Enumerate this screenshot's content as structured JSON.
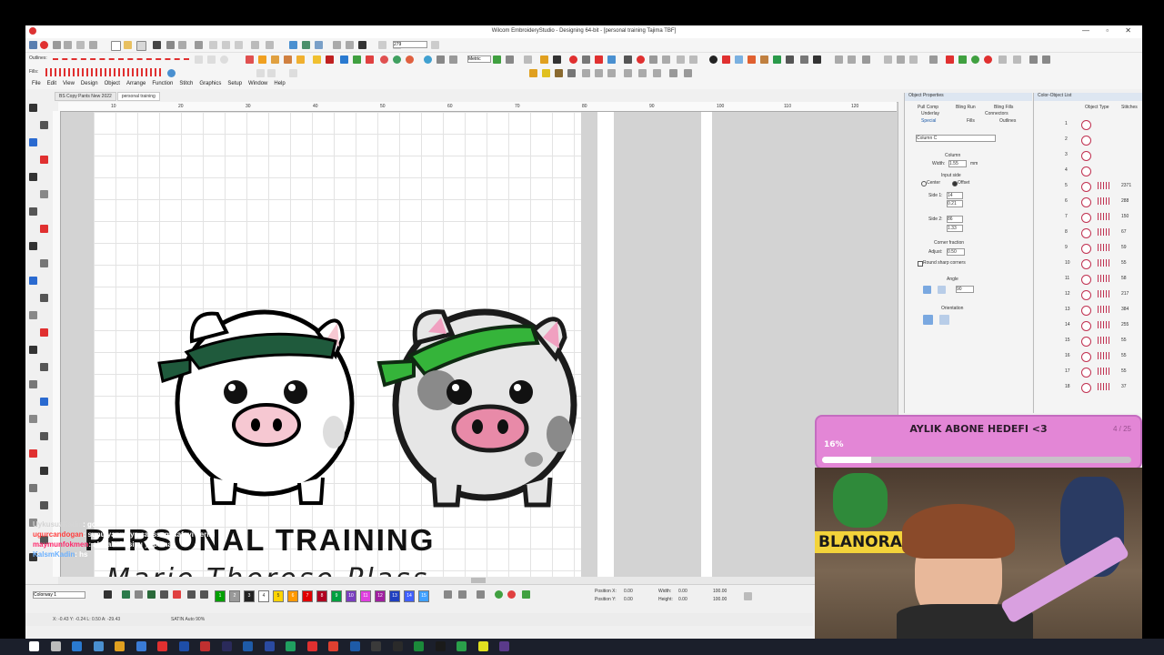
{
  "window": {
    "title": "Wilcom EmbroideryStudio - Designing 64-bit - [personal training      Tajima TBF]"
  },
  "toolbar": {
    "outlines_label": "Outlines:",
    "fills_label": "Fills:",
    "zoom_value": "279",
    "units_value": "Metric"
  },
  "menu": [
    "File",
    "Edit",
    "View",
    "Design",
    "Object",
    "Arrange",
    "Function",
    "Stitch",
    "Graphics",
    "Setup",
    "Window",
    "Help"
  ],
  "doc_tabs": [
    {
      "label": "BS Copy Pants New 2022",
      "active": false
    },
    {
      "label": "personal training",
      "active": true
    }
  ],
  "ruler_labels": [
    "10",
    "20",
    "30",
    "40",
    "50",
    "60",
    "70",
    "80",
    "90",
    "100",
    "110",
    "120"
  ],
  "design": {
    "heading": "PERSONAL TRAINING",
    "name": "Marie-Therese Plass"
  },
  "object_properties": {
    "title": "Object Properties",
    "tabs_row1": [
      "Pull Comp",
      "Bling Run",
      "Bling Fills"
    ],
    "tabs_row2": [
      "Underlay",
      "Connectors"
    ],
    "tabs_row3": [
      "Special",
      "Fills",
      "Outlines"
    ],
    "stitch_type": "Column C",
    "column_label": "Column",
    "width_label": "Width:",
    "width_value": "1.55",
    "unit_mm": "mm",
    "input_side_label": "Input side",
    "center_label": "Center",
    "offset_label": "Offset",
    "side1_label": "Side 1:",
    "side1_pct": "14",
    "side1_mm": "0.21",
    "side2_label": "Side 2:",
    "side2_pct": "86",
    "side2_mm": "1.33",
    "corner_label": "Corner fraction",
    "adjust_label": "Adjust:",
    "adjust_value": "0.50",
    "round_label": "Round sharp corners",
    "angle_label": "Angle",
    "angle_value": "90",
    "orientation_label": "Orientation"
  },
  "color_object_list": {
    "title": "Color-Object List",
    "cols": [
      "Object Type",
      "Stitches"
    ],
    "rows": [
      {
        "n": "1",
        "s": ""
      },
      {
        "n": "2",
        "s": ""
      },
      {
        "n": "3",
        "s": ""
      },
      {
        "n": "4",
        "s": ""
      },
      {
        "n": "5",
        "s": "2371"
      },
      {
        "n": "6",
        "s": "288"
      },
      {
        "n": "7",
        "s": "150"
      },
      {
        "n": "8",
        "s": "67"
      },
      {
        "n": "9",
        "s": "59"
      },
      {
        "n": "10",
        "s": "55"
      },
      {
        "n": "11",
        "s": "58"
      },
      {
        "n": "12",
        "s": "217"
      },
      {
        "n": "13",
        "s": "384"
      },
      {
        "n": "14",
        "s": "255"
      },
      {
        "n": "15",
        "s": "55"
      },
      {
        "n": "16",
        "s": "55"
      },
      {
        "n": "17",
        "s": "55"
      },
      {
        "n": "18",
        "s": "37"
      }
    ]
  },
  "colorway": "Colorway 1",
  "palette": [
    {
      "c": "#00a000",
      "n": "1"
    },
    {
      "c": "#9a9a9a",
      "n": "2"
    },
    {
      "c": "#222222",
      "n": "3"
    },
    {
      "c": "#ffffff",
      "n": "4"
    },
    {
      "c": "#ffd400",
      "n": "5"
    },
    {
      "c": "#ff9900",
      "n": "6"
    },
    {
      "c": "#e00000",
      "n": "7"
    },
    {
      "c": "#b00020",
      "n": "8"
    },
    {
      "c": "#00a040",
      "n": "9"
    },
    {
      "c": "#7a3fbf",
      "n": "10"
    },
    {
      "c": "#e040e0",
      "n": "11"
    },
    {
      "c": "#a020a0",
      "n": "12"
    },
    {
      "c": "#2040c0",
      "n": "13"
    },
    {
      "c": "#4060ff",
      "n": "14"
    },
    {
      "c": "#40a0ff",
      "n": "15"
    }
  ],
  "position": {
    "x_label": "Position X:",
    "y_label": "Position Y:",
    "w_label": "Width:",
    "h_label": "Height:",
    "x": "0.00",
    "y": "0.00",
    "w": "0.00",
    "h": "0.00",
    "wp": "100.00",
    "hp": "100.00"
  },
  "statusbar": {
    "coords": "X: -0.43 Y: -0.24 L: 0.50 A: -29.43",
    "mode": "SATIN Auto 90%"
  },
  "overlay": {
    "goal_title": "AYLIK ABONE HEDEFI <3",
    "goal_percent": "16%",
    "goal_fraction": 0.16,
    "goal_count": "4 / 25",
    "chat": [
      {
        "user": "UykusuzKadin",
        "msg": ": go",
        "color": "#d4d4d4"
      },
      {
        "user": "ugurcandogan",
        "msg": ": sunu yapmaya calissam kafayi yerim",
        "color": "#ff4040"
      },
      {
        "user": "maymunfokmen",
        "msg": ": akalala fojsisu yapamaz",
        "color": "#ff2a6d"
      },
      {
        "user": "KalsmKadin",
        "msg": ": hs",
        "color": "#6ab0ff"
      }
    ],
    "webcam_sign": "BLANORA"
  },
  "colors": {
    "accent_blue": "#1e5ba8",
    "pig_green_dark": "#1f5a3c",
    "pig_green": "#35b43a",
    "goal_pink": "#e386d6"
  }
}
